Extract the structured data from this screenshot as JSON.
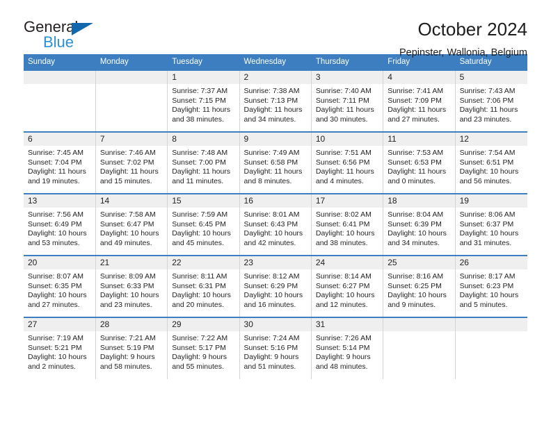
{
  "logo": {
    "word1": "General",
    "word2": "Blue",
    "triangle_color": "#1367ad",
    "word2_color": "#2d8fd5"
  },
  "header": {
    "title": "October 2024",
    "subtitle": "Pepinster, Wallonia, Belgium"
  },
  "theme": {
    "header_bg": "#3c7ebf",
    "header_text": "#ffffff",
    "date_band_bg": "#efefef",
    "row_divider": "#3c7ebf",
    "cell_divider": "#d4d4d4"
  },
  "calendar": {
    "weekday_headers": [
      "Sunday",
      "Monday",
      "Tuesday",
      "Wednesday",
      "Thursday",
      "Friday",
      "Saturday"
    ],
    "weeks": [
      [
        {
          "date": "",
          "empty": true
        },
        {
          "date": "",
          "empty": true
        },
        {
          "date": "1",
          "sunrise": "Sunrise: 7:37 AM",
          "sunset": "Sunset: 7:15 PM",
          "daylight_line1": "Daylight: 11 hours",
          "daylight_line2": "and 38 minutes."
        },
        {
          "date": "2",
          "sunrise": "Sunrise: 7:38 AM",
          "sunset": "Sunset: 7:13 PM",
          "daylight_line1": "Daylight: 11 hours",
          "daylight_line2": "and 34 minutes."
        },
        {
          "date": "3",
          "sunrise": "Sunrise: 7:40 AM",
          "sunset": "Sunset: 7:11 PM",
          "daylight_line1": "Daylight: 11 hours",
          "daylight_line2": "and 30 minutes."
        },
        {
          "date": "4",
          "sunrise": "Sunrise: 7:41 AM",
          "sunset": "Sunset: 7:09 PM",
          "daylight_line1": "Daylight: 11 hours",
          "daylight_line2": "and 27 minutes."
        },
        {
          "date": "5",
          "sunrise": "Sunrise: 7:43 AM",
          "sunset": "Sunset: 7:06 PM",
          "daylight_line1": "Daylight: 11 hours",
          "daylight_line2": "and 23 minutes."
        }
      ],
      [
        {
          "date": "6",
          "sunrise": "Sunrise: 7:45 AM",
          "sunset": "Sunset: 7:04 PM",
          "daylight_line1": "Daylight: 11 hours",
          "daylight_line2": "and 19 minutes."
        },
        {
          "date": "7",
          "sunrise": "Sunrise: 7:46 AM",
          "sunset": "Sunset: 7:02 PM",
          "daylight_line1": "Daylight: 11 hours",
          "daylight_line2": "and 15 minutes."
        },
        {
          "date": "8",
          "sunrise": "Sunrise: 7:48 AM",
          "sunset": "Sunset: 7:00 PM",
          "daylight_line1": "Daylight: 11 hours",
          "daylight_line2": "and 11 minutes."
        },
        {
          "date": "9",
          "sunrise": "Sunrise: 7:49 AM",
          "sunset": "Sunset: 6:58 PM",
          "daylight_line1": "Daylight: 11 hours",
          "daylight_line2": "and 8 minutes."
        },
        {
          "date": "10",
          "sunrise": "Sunrise: 7:51 AM",
          "sunset": "Sunset: 6:56 PM",
          "daylight_line1": "Daylight: 11 hours",
          "daylight_line2": "and 4 minutes."
        },
        {
          "date": "11",
          "sunrise": "Sunrise: 7:53 AM",
          "sunset": "Sunset: 6:53 PM",
          "daylight_line1": "Daylight: 11 hours",
          "daylight_line2": "and 0 minutes."
        },
        {
          "date": "12",
          "sunrise": "Sunrise: 7:54 AM",
          "sunset": "Sunset: 6:51 PM",
          "daylight_line1": "Daylight: 10 hours",
          "daylight_line2": "and 56 minutes."
        }
      ],
      [
        {
          "date": "13",
          "sunrise": "Sunrise: 7:56 AM",
          "sunset": "Sunset: 6:49 PM",
          "daylight_line1": "Daylight: 10 hours",
          "daylight_line2": "and 53 minutes."
        },
        {
          "date": "14",
          "sunrise": "Sunrise: 7:58 AM",
          "sunset": "Sunset: 6:47 PM",
          "daylight_line1": "Daylight: 10 hours",
          "daylight_line2": "and 49 minutes."
        },
        {
          "date": "15",
          "sunrise": "Sunrise: 7:59 AM",
          "sunset": "Sunset: 6:45 PM",
          "daylight_line1": "Daylight: 10 hours",
          "daylight_line2": "and 45 minutes."
        },
        {
          "date": "16",
          "sunrise": "Sunrise: 8:01 AM",
          "sunset": "Sunset: 6:43 PM",
          "daylight_line1": "Daylight: 10 hours",
          "daylight_line2": "and 42 minutes."
        },
        {
          "date": "17",
          "sunrise": "Sunrise: 8:02 AM",
          "sunset": "Sunset: 6:41 PM",
          "daylight_line1": "Daylight: 10 hours",
          "daylight_line2": "and 38 minutes."
        },
        {
          "date": "18",
          "sunrise": "Sunrise: 8:04 AM",
          "sunset": "Sunset: 6:39 PM",
          "daylight_line1": "Daylight: 10 hours",
          "daylight_line2": "and 34 minutes."
        },
        {
          "date": "19",
          "sunrise": "Sunrise: 8:06 AM",
          "sunset": "Sunset: 6:37 PM",
          "daylight_line1": "Daylight: 10 hours",
          "daylight_line2": "and 31 minutes."
        }
      ],
      [
        {
          "date": "20",
          "sunrise": "Sunrise: 8:07 AM",
          "sunset": "Sunset: 6:35 PM",
          "daylight_line1": "Daylight: 10 hours",
          "daylight_line2": "and 27 minutes."
        },
        {
          "date": "21",
          "sunrise": "Sunrise: 8:09 AM",
          "sunset": "Sunset: 6:33 PM",
          "daylight_line1": "Daylight: 10 hours",
          "daylight_line2": "and 23 minutes."
        },
        {
          "date": "22",
          "sunrise": "Sunrise: 8:11 AM",
          "sunset": "Sunset: 6:31 PM",
          "daylight_line1": "Daylight: 10 hours",
          "daylight_line2": "and 20 minutes."
        },
        {
          "date": "23",
          "sunrise": "Sunrise: 8:12 AM",
          "sunset": "Sunset: 6:29 PM",
          "daylight_line1": "Daylight: 10 hours",
          "daylight_line2": "and 16 minutes."
        },
        {
          "date": "24",
          "sunrise": "Sunrise: 8:14 AM",
          "sunset": "Sunset: 6:27 PM",
          "daylight_line1": "Daylight: 10 hours",
          "daylight_line2": "and 12 minutes."
        },
        {
          "date": "25",
          "sunrise": "Sunrise: 8:16 AM",
          "sunset": "Sunset: 6:25 PM",
          "daylight_line1": "Daylight: 10 hours",
          "daylight_line2": "and 9 minutes."
        },
        {
          "date": "26",
          "sunrise": "Sunrise: 8:17 AM",
          "sunset": "Sunset: 6:23 PM",
          "daylight_line1": "Daylight: 10 hours",
          "daylight_line2": "and 5 minutes."
        }
      ],
      [
        {
          "date": "27",
          "sunrise": "Sunrise: 7:19 AM",
          "sunset": "Sunset: 5:21 PM",
          "daylight_line1": "Daylight: 10 hours",
          "daylight_line2": "and 2 minutes."
        },
        {
          "date": "28",
          "sunrise": "Sunrise: 7:21 AM",
          "sunset": "Sunset: 5:19 PM",
          "daylight_line1": "Daylight: 9 hours",
          "daylight_line2": "and 58 minutes."
        },
        {
          "date": "29",
          "sunrise": "Sunrise: 7:22 AM",
          "sunset": "Sunset: 5:17 PM",
          "daylight_line1": "Daylight: 9 hours",
          "daylight_line2": "and 55 minutes."
        },
        {
          "date": "30",
          "sunrise": "Sunrise: 7:24 AM",
          "sunset": "Sunset: 5:16 PM",
          "daylight_line1": "Daylight: 9 hours",
          "daylight_line2": "and 51 minutes."
        },
        {
          "date": "31",
          "sunrise": "Sunrise: 7:26 AM",
          "sunset": "Sunset: 5:14 PM",
          "daylight_line1": "Daylight: 9 hours",
          "daylight_line2": "and 48 minutes."
        },
        {
          "date": "",
          "empty": true
        },
        {
          "date": "",
          "empty": true
        }
      ]
    ]
  }
}
